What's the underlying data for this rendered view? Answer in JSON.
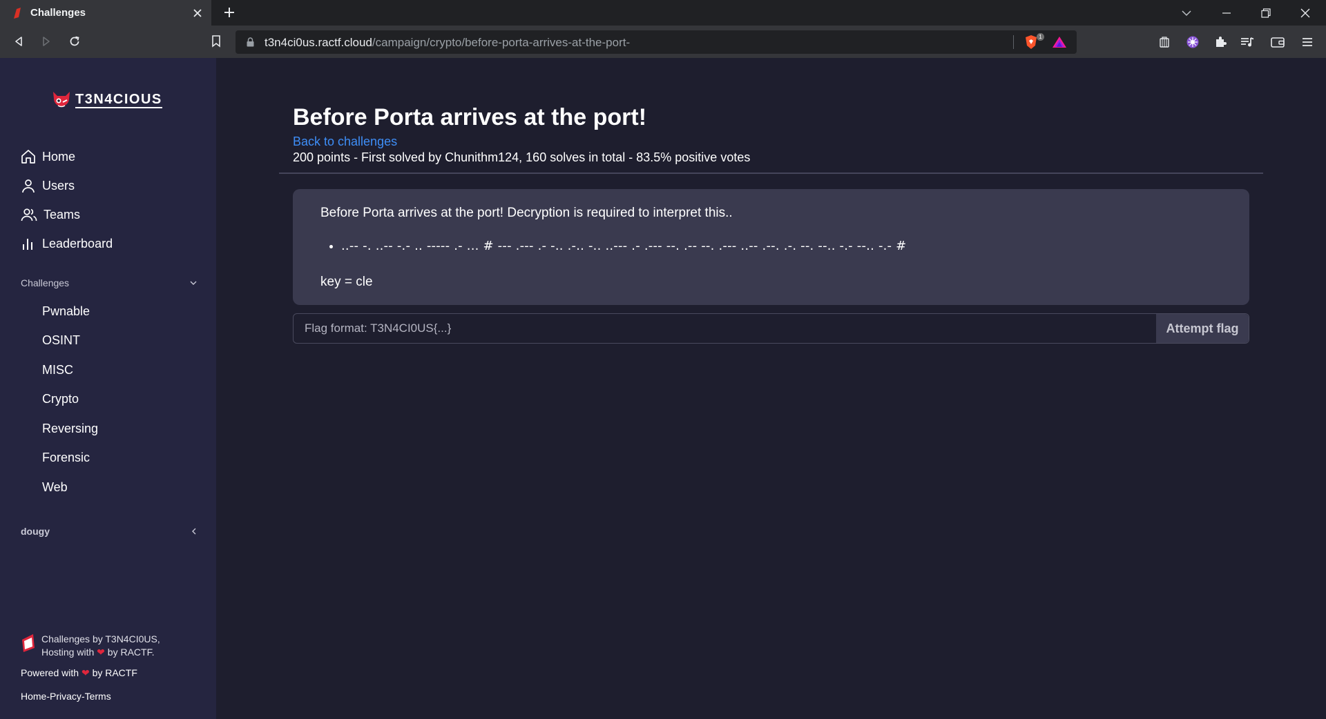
{
  "browser": {
    "tab_title": "Challenges",
    "url_host": "t3n4ci0us.ractf.cloud",
    "url_path": "/campaign/crypto/before-porta-arrives-at-the-port-",
    "shields_count": "1"
  },
  "sidebar": {
    "logo_text": "T3N4CIOUS",
    "nav": [
      {
        "label": "Home",
        "icon": "home-icon"
      },
      {
        "label": "Users",
        "icon": "user-icon"
      },
      {
        "label": "Teams",
        "icon": "users-icon"
      },
      {
        "label": "Leaderboard",
        "icon": "bar-chart-icon"
      }
    ],
    "challenges_heading": "Challenges",
    "categories": [
      "Pwnable",
      "OSINT",
      "MISC",
      "Crypto",
      "Reversing",
      "Forensic",
      "Web"
    ],
    "user_heading": "dougy",
    "footer": {
      "brand_line1": "Challenges by T3N4CI0US,",
      "brand_line2_pre": "Hosting with",
      "brand_line2_post": "by RACTF.",
      "powered_pre": "Powered with",
      "powered_post": "by RACTF",
      "links": [
        "Home",
        "Privacy",
        "Terms"
      ],
      "separator": "-"
    }
  },
  "challenge": {
    "title": "Before Porta arrives at the port!",
    "back_link": "Back to challenges",
    "meta": "200 points - First solved by Chunithm124, 160 solves in total - 83.5% positive votes",
    "intro": "Before Porta arrives at the port! Decryption is required to interpret this..",
    "cipher": "..-- -. ..-- -.- .. ----- .- ... # --- .--- .- -.. .-.. -.. ..--- .- .--- --. .-- --. .--- ..-- .--. .-. --. --.. -.- --.. -.- #",
    "key": "key = cle"
  },
  "flag": {
    "placeholder": "Flag format: T3N4CI0US{...}",
    "button": "Attempt flag"
  },
  "colors": {
    "background": "#1e1e2e",
    "sidebar": "#252540",
    "card": "#3a3a4f",
    "link": "#3e8ef7",
    "heart": "#e0263c"
  }
}
